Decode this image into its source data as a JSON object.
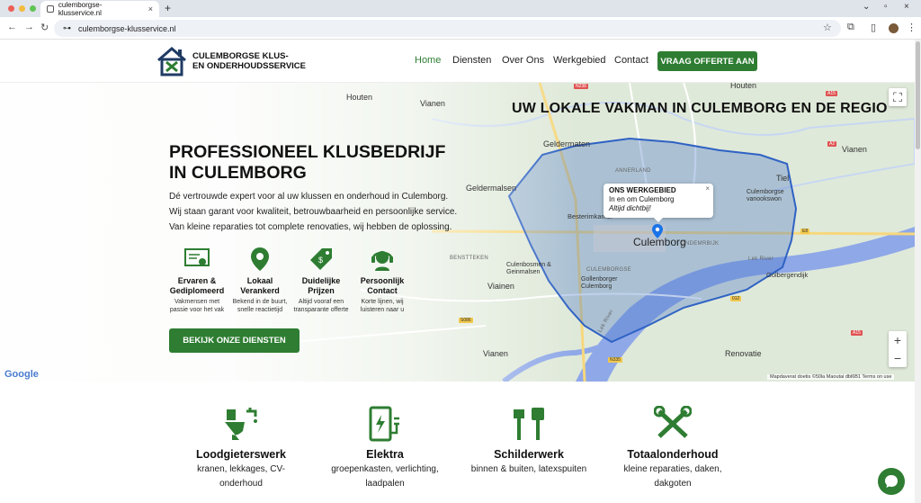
{
  "browser": {
    "tab_title": "culemborgse-klusservice.nl",
    "url": "culemborgse-klusservice.nl"
  },
  "header": {
    "logo_line1": "CULEMBORGSE KLUS-",
    "logo_line2": "EN ONDERHOUDSSERVICE",
    "nav": [
      "Home",
      "Diensten",
      "Over Ons",
      "Werkgebied",
      "Contact"
    ],
    "cta": "VRAAG OFFERTE AAN"
  },
  "hero": {
    "map_title": "UW LOKALE VAKMAN IN CULEMBORG EN DE REGIO",
    "title_line1": "PROFESSIONEEL KLUSBEDRIJF",
    "title_line2": "IN CULEMBORG",
    "paragraph": [
      "Dé vertrouwde expert voor al uw klussen en onderhoud in Culemborg.",
      "Wij staan garant voor kwaliteit, betrouwbaarheid en persoonlijke service.",
      "Van kleine reparaties tot complete renovaties, wij hebben de oplossing."
    ],
    "features": [
      {
        "title": "Ervaren & Gediplomeerd",
        "desc": "Vakmensen met passie voor het vak",
        "icon": "certificate-icon"
      },
      {
        "title": "Lokaal Verankerd",
        "desc": "Bekend in de buurt, snelle reactietijd",
        "icon": "map-pin-icon"
      },
      {
        "title": "Duidelijke Prijzen",
        "desc": "Altijd vooraf een transparante offerte",
        "icon": "price-tag-icon"
      },
      {
        "title": "Persoonlijk Contact",
        "desc": "Korte lijnen, wij luisteren naar u",
        "icon": "headset-icon"
      }
    ],
    "cta": "BEKIJK ONZE DIENSTEN"
  },
  "map": {
    "popup_title": "ONS WERKGEBIED",
    "popup_line": "In en om Culemborg",
    "popup_italic": "Altijd dichtbij!",
    "popup_close": "×",
    "places": {
      "houten_left": "Houten",
      "houten_right": "Houten",
      "vianen_top": "Vianen",
      "geldermalsen": "Geldermalsen",
      "geldermusen": "Geldermaten",
      "culemborg": "Culemborg",
      "tiel": "Tiel",
      "vianen_right": "Vianen",
      "vianen_mid": "Viainen",
      "vianen_bottom": "Vianen",
      "renovatie": "Renovatie",
      "lek_river": "Lek River",
      "lek_river_2": "Lek River",
      "golbergen": "Golbergendijk",
      "culenbosch": "Culenbosmen & Geinmalsen",
      "gollenborger": "Gollenborger Culemborg",
      "culemborgse_vanookswon": "Culemborgse vanookswon",
      "besterimkamer": "Besterimkamer",
      "benstteken": "BENSTTEKEN",
      "culemborgse_small": "CULEMBORGSE",
      "annerland": "ANNERLAND",
      "ondermrijk": "ONDEMRBIJK",
      "mercijn": "MAERCIJN"
    },
    "roads": [
      "N238",
      "A15",
      "E18",
      "E8",
      "A2",
      "N1",
      "S08",
      "012",
      "A15",
      "N28",
      "N335",
      "S1",
      "S086"
    ],
    "google": "Google",
    "attribution": "Mapdaverat doetis ©50la     Maoutai dbl6B1     Terms on use",
    "zoom_in": "+",
    "zoom_out": "−",
    "fullscreen": "⛶"
  },
  "services": [
    {
      "title": "Loodgieterswerk",
      "desc": [
        "kranen, lekkages, CV-",
        "onderhoud"
      ],
      "icon": "toilet-faucet-icon"
    },
    {
      "title": "Elektra",
      "desc": [
        "groepenkasten, verlichting,",
        "laadpalen"
      ],
      "icon": "electric-panel-icon"
    },
    {
      "title": "Schilderwerk",
      "desc": [
        "binnen & buiten, latexspuiten",
        ""
      ],
      "icon": "paint-brush-icon"
    },
    {
      "title": "Totaalonderhoud",
      "desc": [
        "kleine reparaties, daken,",
        "dakgoten"
      ],
      "icon": "tools-icon"
    }
  ],
  "colors": {
    "brand_green": "#2e7d32",
    "map_area": "#4a78c8",
    "water": "#8fa8e8"
  }
}
